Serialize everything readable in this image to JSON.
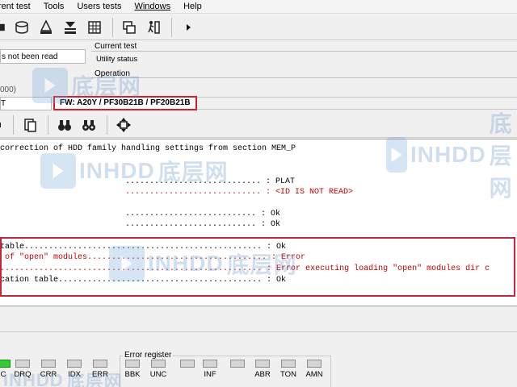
{
  "menu": {
    "items": [
      "rent test",
      "Tools",
      "Users tests",
      "Windows",
      "Help"
    ]
  },
  "status": {
    "left_status": "s not been read",
    "left_model": "000)",
    "left_field": "T",
    "current_test_label": "Current test",
    "current_test_value": "Utility status",
    "operation_label": "Operation",
    "fw_text": "FW: A20Y / PF30B21B / PF20B21B"
  },
  "log": {
    "lines": [
      {
        "text": "correction of HDD family handling settings from section MEM_P",
        "kind": "ok"
      },
      {
        "text": "............................ : PLAT",
        "kind": "ok"
      },
      {
        "text": "............................ : <ID IS NOT READ>",
        "kind": "err"
      },
      {
        "text": "........................... : Ok",
        "kind": "ok"
      },
      {
        "text": "........................... : Ok",
        "kind": "ok"
      },
      {
        "text": "table................................................. : Ok",
        "kind": "ok"
      },
      {
        "text": " of \"open\" modules..................................... : Error",
        "kind": "err"
      },
      {
        "text": "...................................................... : Error executing loading \"open\" modules dir c",
        "kind": "err"
      },
      {
        "text": "cation table.......................................... : Ok",
        "kind": "ok"
      }
    ]
  },
  "registers": {
    "group_label": "Error register",
    "status_leds": [
      {
        "label": "C",
        "on": true
      },
      {
        "label": "DRQ",
        "on": false
      },
      {
        "label": "CRR",
        "on": false
      },
      {
        "label": "IDX",
        "on": false
      },
      {
        "label": "ERR",
        "on": false
      }
    ],
    "error_leds": [
      {
        "label": "BBK",
        "on": false
      },
      {
        "label": "UNC",
        "on": false
      },
      {
        "label": "INF",
        "on": false
      },
      {
        "label": "",
        "on": false
      },
      {
        "label": "ABR",
        "on": false
      },
      {
        "label": "TON",
        "on": false
      },
      {
        "label": "AMN",
        "on": false
      }
    ]
  },
  "watermark": {
    "logo_text": "INHDD",
    "cn_text": "底层网"
  },
  "colors": {
    "highlight_red": "#d0202a",
    "error_text": "#c00000",
    "led_on": "#33cc33"
  }
}
